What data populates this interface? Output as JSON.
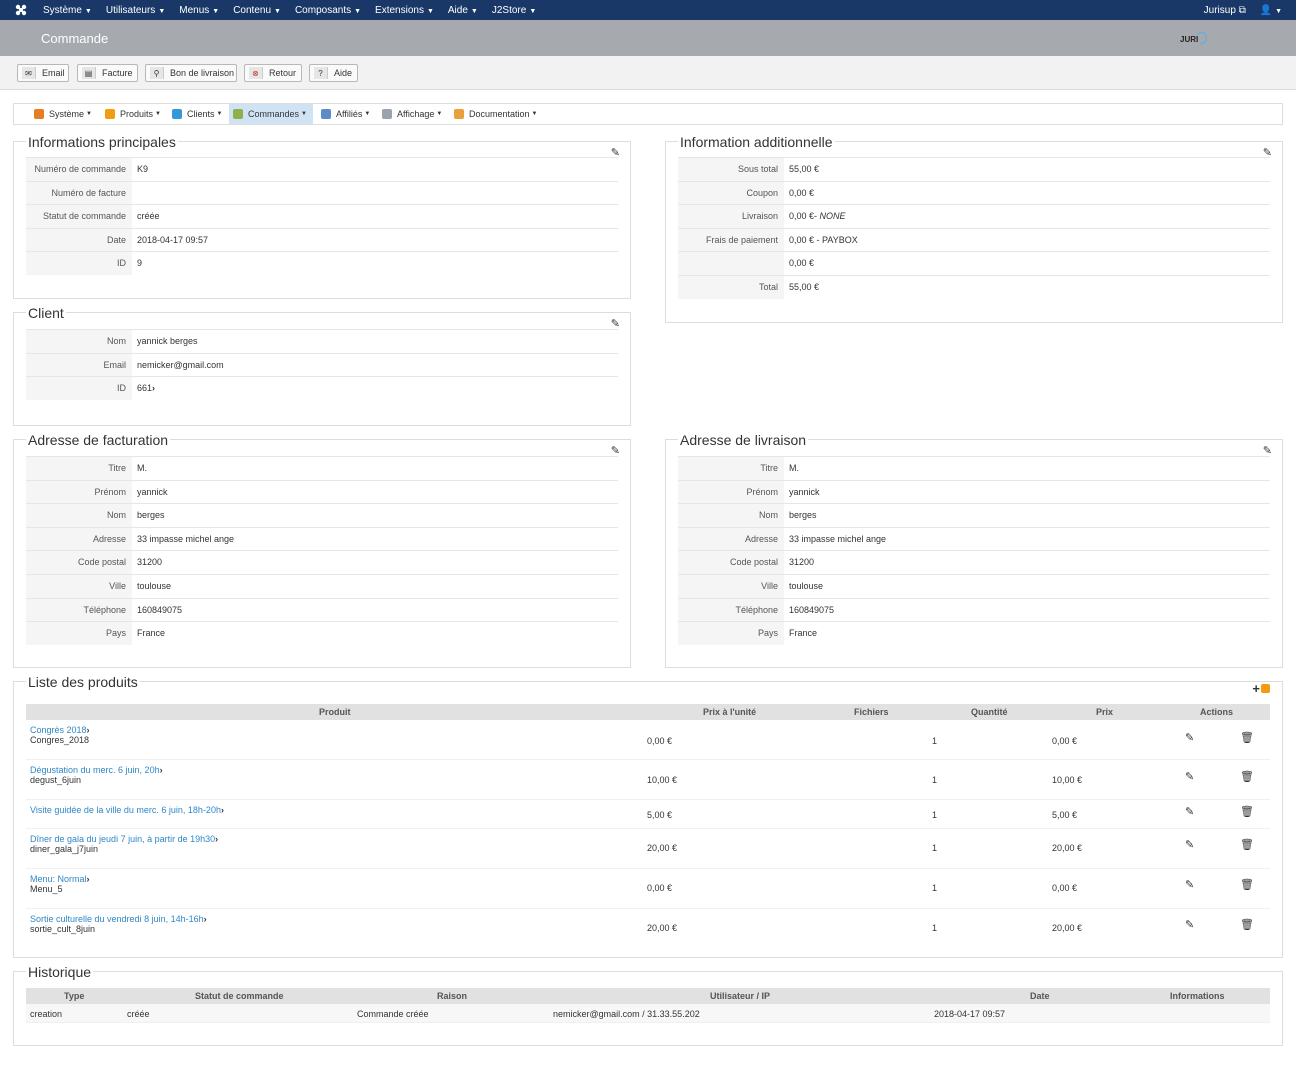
{
  "topbar": {
    "menu": [
      "Système",
      "Utilisateurs",
      "Menus",
      "Contenu",
      "Composants",
      "Extensions",
      "Aide",
      "J2Store"
    ],
    "user": "Jurisup"
  },
  "page": {
    "title": "Commande"
  },
  "toolbar": {
    "email": "Email",
    "invoice": "Facture",
    "delivery_note": "Bon de livraison",
    "back": "Retour",
    "help": "Aide"
  },
  "submenu": [
    "Système",
    "Produits",
    "Clients",
    "Commandes",
    "Affiliés",
    "Affichage",
    "Documentation"
  ],
  "main_info": {
    "legend": "Informations principales",
    "rows": [
      {
        "k": "Numéro de commande",
        "v": "K9"
      },
      {
        "k": "Numéro de facture",
        "v": ""
      },
      {
        "k": "Statut de commande",
        "v": "créée"
      },
      {
        "k": "Date",
        "v": "2018-04-17 09:57"
      },
      {
        "k": "ID",
        "v": "9"
      }
    ]
  },
  "additional_info": {
    "legend": "Information additionnelle",
    "rows": [
      {
        "k": "Sous total",
        "v": "55,00 €"
      },
      {
        "k": "Coupon",
        "v": "0,00 €"
      },
      {
        "k": "Livraison",
        "v": "0,00 €- ",
        "vi": "NONE"
      },
      {
        "k": "Frais de paiement",
        "v": "0,00 € - PAYBOX"
      },
      {
        "k": "",
        "v": "0,00 €"
      },
      {
        "k": "Total",
        "v": "55,00 €"
      }
    ]
  },
  "client": {
    "legend": "Client",
    "rows": [
      {
        "k": "Nom",
        "v": "yannick berges"
      },
      {
        "k": "Email",
        "v": "nemicker@gmail.com"
      },
      {
        "k": "ID",
        "v": "661"
      }
    ]
  },
  "billing": {
    "legend": "Adresse de facturation",
    "rows": [
      {
        "k": "Titre",
        "v": "M."
      },
      {
        "k": "Prénom",
        "v": "yannick"
      },
      {
        "k": "Nom",
        "v": "berges"
      },
      {
        "k": "Adresse",
        "v": "33 impasse michel ange"
      },
      {
        "k": "Code postal",
        "v": "31200"
      },
      {
        "k": "Ville",
        "v": "toulouse"
      },
      {
        "k": "Téléphone",
        "v": "160849075"
      },
      {
        "k": "Pays",
        "v": "France"
      }
    ]
  },
  "shipping": {
    "legend": "Adresse de livraison",
    "rows": [
      {
        "k": "Titre",
        "v": "M."
      },
      {
        "k": "Prénom",
        "v": "yannick"
      },
      {
        "k": "Nom",
        "v": "berges"
      },
      {
        "k": "Adresse",
        "v": "33 impasse michel ange"
      },
      {
        "k": "Code postal",
        "v": "31200"
      },
      {
        "k": "Ville",
        "v": "toulouse"
      },
      {
        "k": "Téléphone",
        "v": "160849075"
      },
      {
        "k": "Pays",
        "v": "France"
      }
    ]
  },
  "products": {
    "legend": "Liste des produits",
    "headers": [
      "Produit",
      "Prix à l'unité",
      "Fichiers",
      "Quantité",
      "Prix",
      "Actions"
    ],
    "rows": [
      {
        "name": "Congrès 2018",
        "sku": "Congres_2018",
        "unit": "0,00 €",
        "qty": "1",
        "price": "0,00 €"
      },
      {
        "name": "Dégustation du merc. 6 juin, 20h",
        "sku": "degust_6juin",
        "unit": "10,00 €",
        "qty": "1",
        "price": "10,00 €"
      },
      {
        "name": "Visite guidée de la ville du merc. 6 juin, 18h-20h",
        "sku": "",
        "unit": "5,00 €",
        "qty": "1",
        "price": "5,00 €"
      },
      {
        "name": "Dîner de gala du jeudi 7 juin, à partir de 19h30",
        "sku": "diner_gala_j7juin",
        "unit": "20,00 €",
        "qty": "1",
        "price": "20,00 €"
      },
      {
        "name": "Menu: Normal",
        "sku": "Menu_5",
        "unit": "0,00 €",
        "qty": "1",
        "price": "0,00 €"
      },
      {
        "name": "Sortie culturelle du vendredi 8 juin, 14h-16h",
        "sku": "sortie_cult_8juin",
        "unit": "20,00 €",
        "qty": "1",
        "price": "20,00 €"
      }
    ]
  },
  "history": {
    "legend": "Historique",
    "headers": [
      "Type",
      "Statut de commande",
      "Raison",
      "Utilisateur / IP",
      "Date",
      "Informations"
    ],
    "rows": [
      {
        "type": "creation",
        "status": "créée",
        "reason": "Commande créée",
        "user": "nemicker@gmail.com / 31.33.55.202",
        "date": "2018-04-17 09:57",
        "info": ""
      }
    ]
  }
}
